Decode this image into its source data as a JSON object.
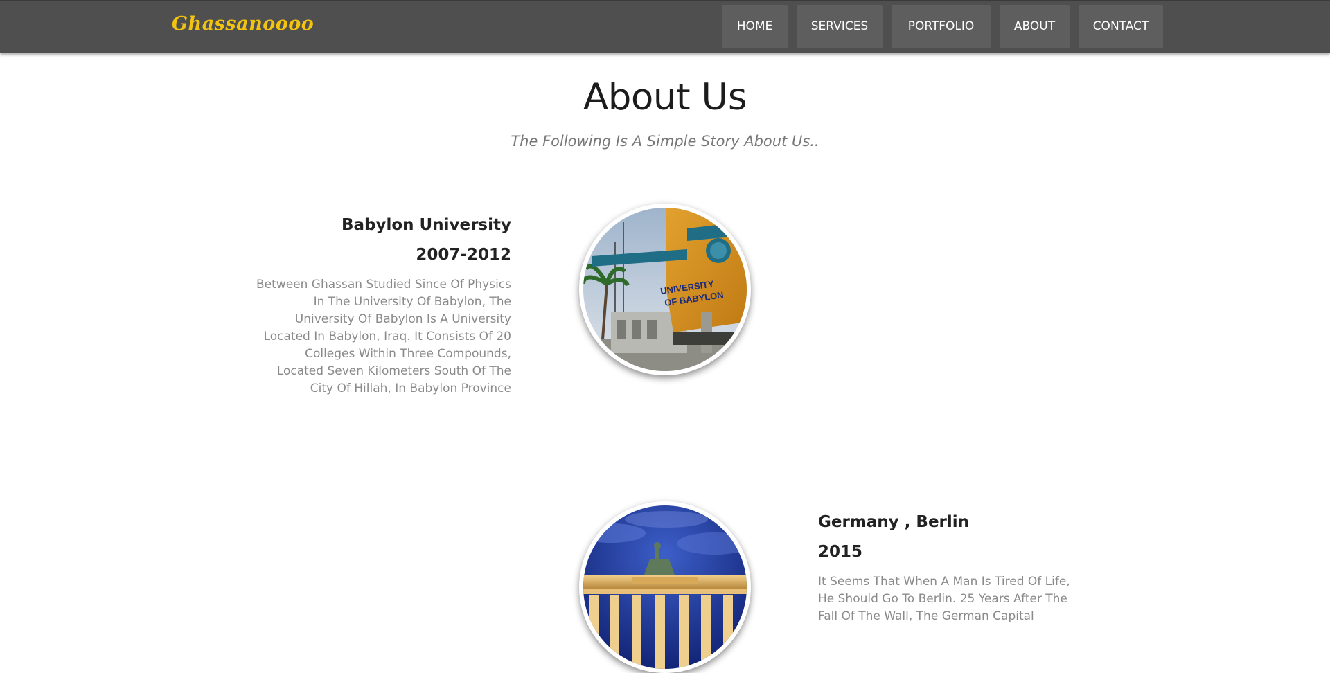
{
  "brand": "Ghassanoooo",
  "nav": {
    "items": [
      "HOME",
      "SERVICES",
      "PORTFOLIO",
      "ABOUT",
      "CONTACT"
    ]
  },
  "about": {
    "title": "About Us",
    "subtitle": "The Following Is A Simple Story About Us.."
  },
  "timeline": [
    {
      "heading": "Babylon University",
      "date": "2007-2012",
      "body": "Between Ghassan Studied Since Of Physics In The University Of Babylon, The University Of Babylon Is A University Located In Babylon, Iraq. It Consists Of 20 Colleges Within Three Compounds, Located Seven Kilometers South Of The City Of Hillah, In Babylon Province",
      "image_sign_text": "UNIVERSITY OF BABYLON"
    },
    {
      "heading": "Germany , Berlin",
      "date": "2015",
      "body": "It Seems That When A Man Is Tired Of Life, He Should Go To Berlin. 25 Years After The Fall Of The Wall, The German Capital"
    }
  ],
  "colors": {
    "navbar": "#4f4f4f",
    "nav_button": "#5e5e5e",
    "brand": "#f2c40f",
    "body_text": "#8a8a8a",
    "heading_text": "#222222"
  }
}
